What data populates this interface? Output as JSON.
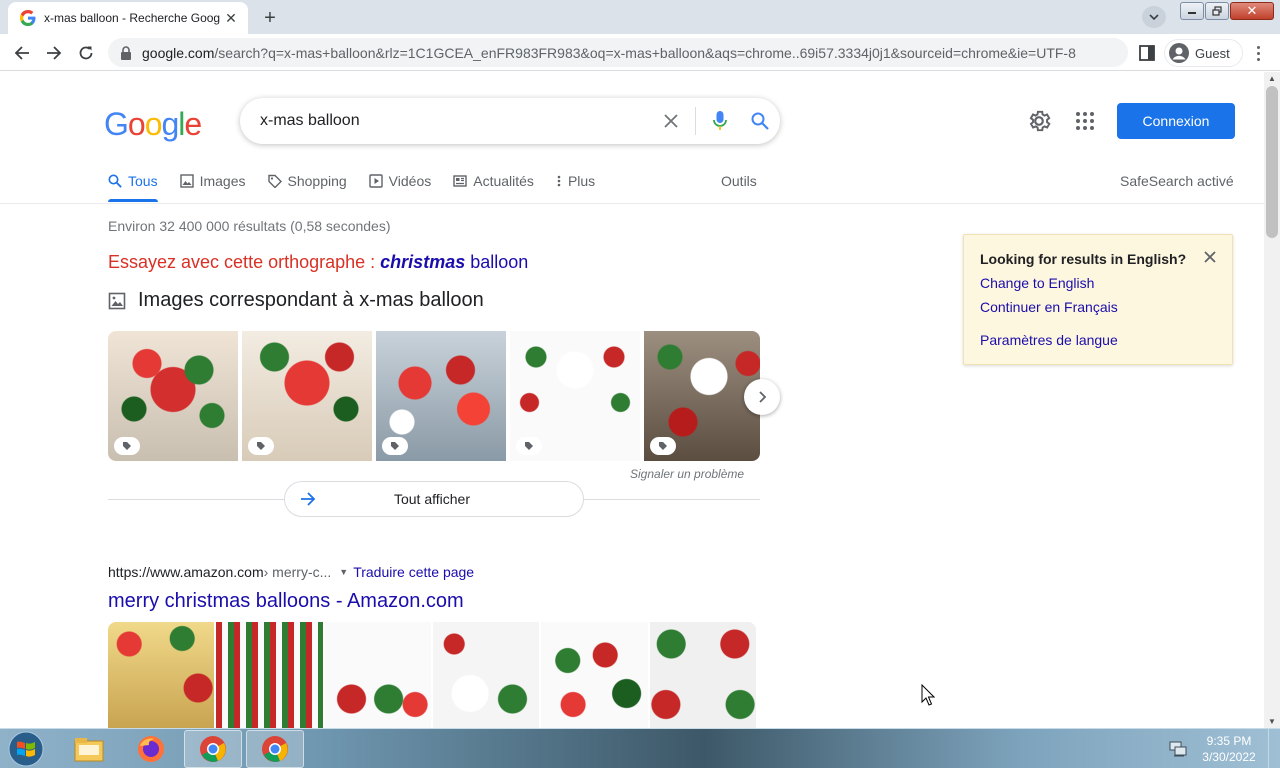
{
  "browser": {
    "tab_title": "x-mas balloon - Recherche Goog",
    "url_host": "google.com",
    "url_rest": "/search?q=x-mas+balloon&rlz=1C1GCEA_enFR983FR983&oq=x-mas+balloon&aqs=chrome..69i57.3334j0j1&sourceid=chrome&ie=UTF-8",
    "profile_label": "Guest"
  },
  "google": {
    "logo": "Google",
    "query": "x-mas balloon",
    "signin_label": "Connexion",
    "tabs": [
      {
        "label": "Tous",
        "icon": "search-icon"
      },
      {
        "label": "Images",
        "icon": "image-icon"
      },
      {
        "label": "Shopping",
        "icon": "tag-icon"
      },
      {
        "label": "Vidéos",
        "icon": "play-icon"
      },
      {
        "label": "Actualités",
        "icon": "news-icon"
      },
      {
        "label": "Plus",
        "icon": "more-vert-icon"
      }
    ],
    "tools_label": "Outils",
    "safesearch_label": "SafeSearch activé",
    "result_stats": "Environ 32 400 000 résultats (0,58 secondes)",
    "spell": {
      "prefix": "Essayez avec cette orthographe :",
      "bold_word": "christmas",
      "rest": "balloon"
    },
    "images_section": {
      "title": "Images correspondant à x-mas balloon",
      "report": "Signaler un problème",
      "see_all": "Tout afficher"
    },
    "result": {
      "cite_host": "https://www.amazon.com",
      "cite_path": " › merry-c...",
      "translate": "Traduire cette page",
      "title": "merry christmas balloons - Amazon.com"
    },
    "lang_card": {
      "title": "Looking for results in English?",
      "change": "Change to English",
      "continue": "Continuer en Français",
      "settings": "Paramètres de langue"
    }
  },
  "taskbar": {
    "time": "9:35 PM",
    "date": "3/30/2022"
  },
  "colors": {
    "google_blue": "#1a73e8",
    "link": "#1a0dab",
    "spell_red": "#d93025",
    "lang_card_bg": "#fef7e0"
  }
}
